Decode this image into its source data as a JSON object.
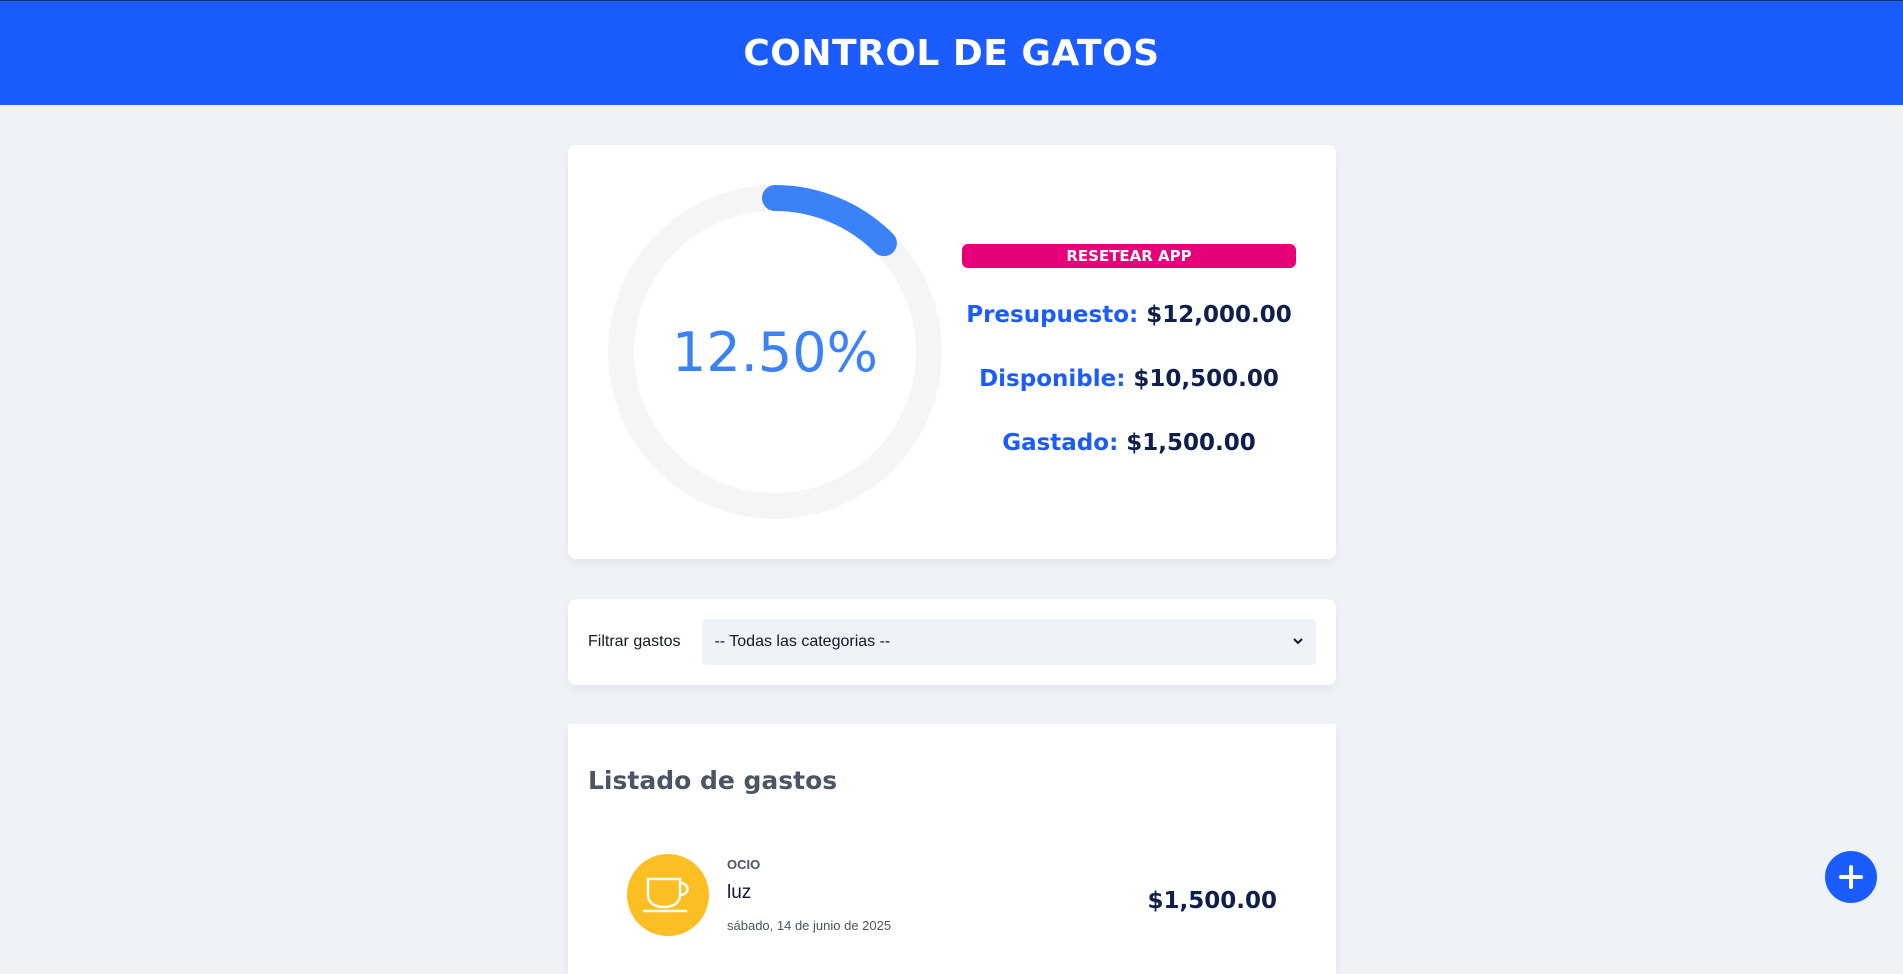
{
  "header": {
    "title": "CONTROL DE GATOS"
  },
  "budget": {
    "percent_spent": 12.5,
    "percent_label": "12.50%",
    "reset_label": "RESETEAR APP",
    "rows": [
      {
        "label": "Presupuesto:",
        "value": "$12,000.00"
      },
      {
        "label": "Disponible:",
        "value": "$10,500.00"
      },
      {
        "label": "Gastado:",
        "value": "$1,500.00"
      }
    ],
    "colors": {
      "progress": "#3b82f6",
      "track": "#f5f5f5",
      "reset": "#e6007a"
    }
  },
  "filter": {
    "label": "Filtrar gastos",
    "selected": "-- Todas las categorias --"
  },
  "list": {
    "title": "Listado de gastos",
    "expenses": [
      {
        "category": "OCIO",
        "name": "luz",
        "date": "sábado, 14 de junio de 2025",
        "amount": "$1,500.00",
        "icon": "cup-icon",
        "icon_color": "#fbbf24"
      }
    ]
  },
  "fab": {
    "icon": "plus-icon"
  }
}
